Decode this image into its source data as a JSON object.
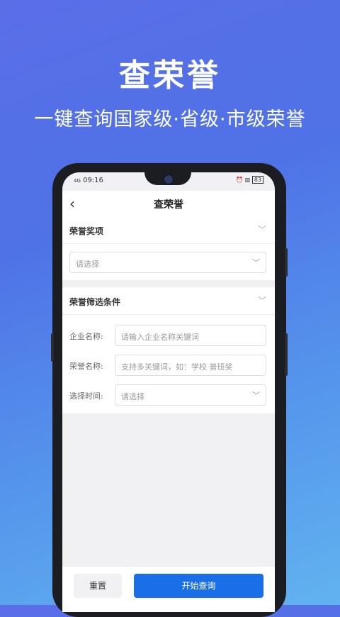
{
  "hero": {
    "title": "查荣誉",
    "subtitle": "一键查询国家级·省级·市级荣誉"
  },
  "status_bar": {
    "signal": "4G",
    "time": "09:16",
    "battery": "83"
  },
  "nav": {
    "back_icon": "chevron-left-icon",
    "title": "查荣誉"
  },
  "award_section": {
    "heading": "荣誉奖项",
    "select_placeholder": "请选择"
  },
  "filter_section": {
    "heading": "荣誉筛选条件",
    "fields": [
      {
        "label": "企业名称:",
        "placeholder": "请输入企业名称关键词"
      },
      {
        "label": "荣誉名称:",
        "placeholder": "支持多关键词，如：学校 普班奖"
      },
      {
        "label": "选择时间:",
        "placeholder": "请选择"
      }
    ]
  },
  "actions": {
    "reset_label": "重置",
    "query_label": "开始查询"
  },
  "colors": {
    "primary": "#1a6fe8",
    "background_top": "#5a6ee8",
    "background_bottom": "#62b2ef"
  }
}
